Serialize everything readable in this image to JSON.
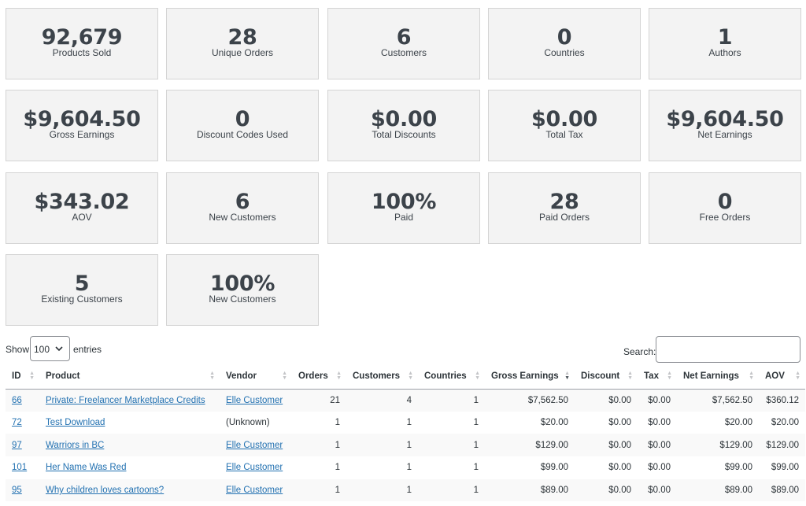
{
  "stats": [
    {
      "value": "92,679",
      "label": "Products Sold"
    },
    {
      "value": "28",
      "label": "Unique Orders"
    },
    {
      "value": "6",
      "label": "Customers"
    },
    {
      "value": "0",
      "label": "Countries"
    },
    {
      "value": "1",
      "label": "Authors"
    },
    {
      "value": "$9,604.50",
      "label": "Gross Earnings"
    },
    {
      "value": "0",
      "label": "Discount Codes Used"
    },
    {
      "value": "$0.00",
      "label": "Total Discounts"
    },
    {
      "value": "$0.00",
      "label": "Total Tax"
    },
    {
      "value": "$9,604.50",
      "label": "Net Earnings"
    },
    {
      "value": "$343.02",
      "label": "AOV"
    },
    {
      "value": "6",
      "label": "New Customers"
    },
    {
      "value": "100%",
      "label": "Paid"
    },
    {
      "value": "28",
      "label": "Paid Orders"
    },
    {
      "value": "0",
      "label": "Free Orders"
    },
    {
      "value": "5",
      "label": "Existing Customers"
    },
    {
      "value": "100%",
      "label": "New Customers"
    }
  ],
  "controls": {
    "show_label": "Show",
    "page_length": "100",
    "entries_label": "entries",
    "search_label": "Search:",
    "search_value": ""
  },
  "table": {
    "headers": {
      "id": "ID",
      "product": "Product",
      "vendor": "Vendor",
      "orders": "Orders",
      "customers": "Customers",
      "countries": "Countries",
      "gross": "Gross Earnings",
      "discount": "Discount",
      "tax": "Tax",
      "net": "Net Earnings",
      "aov": "AOV"
    },
    "rows": [
      {
        "id": "66",
        "product": "Private: Freelancer Marketplace Credits",
        "vendor": "Elle Customer",
        "orders": "21",
        "customers": "4",
        "countries": "1",
        "gross": "$7,562.50",
        "discount": "$0.00",
        "tax": "$0.00",
        "net": "$7,562.50",
        "aov": "$360.12"
      },
      {
        "id": "72",
        "product": "Test Download",
        "vendor": "(Unknown)",
        "orders": "1",
        "customers": "1",
        "countries": "1",
        "gross": "$20.00",
        "discount": "$0.00",
        "tax": "$0.00",
        "net": "$20.00",
        "aov": "$20.00"
      },
      {
        "id": "97",
        "product": "Warriors in BC",
        "vendor": "Elle Customer",
        "orders": "1",
        "customers": "1",
        "countries": "1",
        "gross": "$129.00",
        "discount": "$0.00",
        "tax": "$0.00",
        "net": "$129.00",
        "aov": "$129.00"
      },
      {
        "id": "101",
        "product": "Her Name Was Red",
        "vendor": "Elle Customer",
        "orders": "1",
        "customers": "1",
        "countries": "1",
        "gross": "$99.00",
        "discount": "$0.00",
        "tax": "$0.00",
        "net": "$99.00",
        "aov": "$99.00"
      },
      {
        "id": "95",
        "product": "Why children loves cartoons?",
        "vendor": "Elle Customer",
        "orders": "1",
        "customers": "1",
        "countries": "1",
        "gross": "$89.00",
        "discount": "$0.00",
        "tax": "$0.00",
        "net": "$89.00",
        "aov": "$89.00"
      }
    ]
  }
}
